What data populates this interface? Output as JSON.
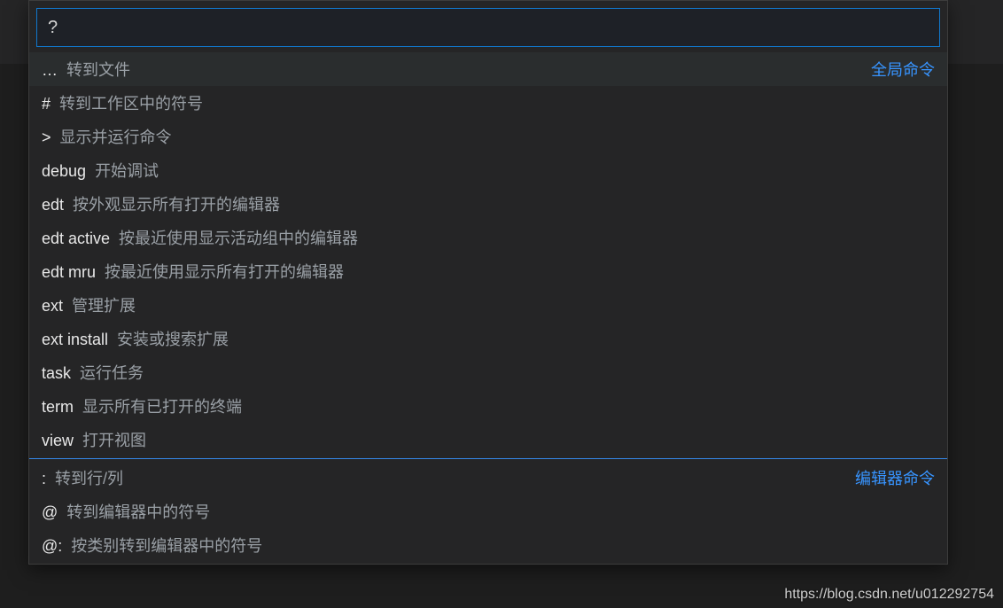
{
  "input": {
    "value": "?"
  },
  "groups": {
    "global_label": "全局命令",
    "editor_label": "编辑器命令"
  },
  "global_items": [
    {
      "prefix": "…",
      "desc": "转到文件",
      "focused": true,
      "groupHeader": true
    },
    {
      "prefix": "#",
      "desc": "转到工作区中的符号",
      "focused": false,
      "groupHeader": false
    },
    {
      "prefix": ">",
      "desc": "显示并运行命令",
      "focused": false,
      "groupHeader": false
    },
    {
      "prefix": "debug",
      "desc": "开始调试",
      "focused": false,
      "groupHeader": false
    },
    {
      "prefix": "edt",
      "desc": "按外观显示所有打开的编辑器",
      "focused": false,
      "groupHeader": false
    },
    {
      "prefix": "edt active",
      "desc": "按最近使用显示活动组中的编辑器",
      "focused": false,
      "groupHeader": false
    },
    {
      "prefix": "edt mru",
      "desc": "按最近使用显示所有打开的编辑器",
      "focused": false,
      "groupHeader": false
    },
    {
      "prefix": "ext",
      "desc": "管理扩展",
      "focused": false,
      "groupHeader": false
    },
    {
      "prefix": "ext install",
      "desc": "安装或搜索扩展",
      "focused": false,
      "groupHeader": false
    },
    {
      "prefix": "task",
      "desc": "运行任务",
      "focused": false,
      "groupHeader": false
    },
    {
      "prefix": "term",
      "desc": "显示所有已打开的终端",
      "focused": false,
      "groupHeader": false
    },
    {
      "prefix": "view",
      "desc": "打开视图",
      "focused": false,
      "groupHeader": false
    }
  ],
  "editor_items": [
    {
      "prefix": ":",
      "desc": "转到行/列",
      "focused": false,
      "groupHeader": true
    },
    {
      "prefix": "@",
      "desc": "转到编辑器中的符号",
      "focused": false,
      "groupHeader": false
    },
    {
      "prefix": "@:",
      "desc": "按类别转到编辑器中的符号",
      "focused": false,
      "groupHeader": false
    }
  ],
  "watermark": "https://blog.csdn.net/u012292754"
}
